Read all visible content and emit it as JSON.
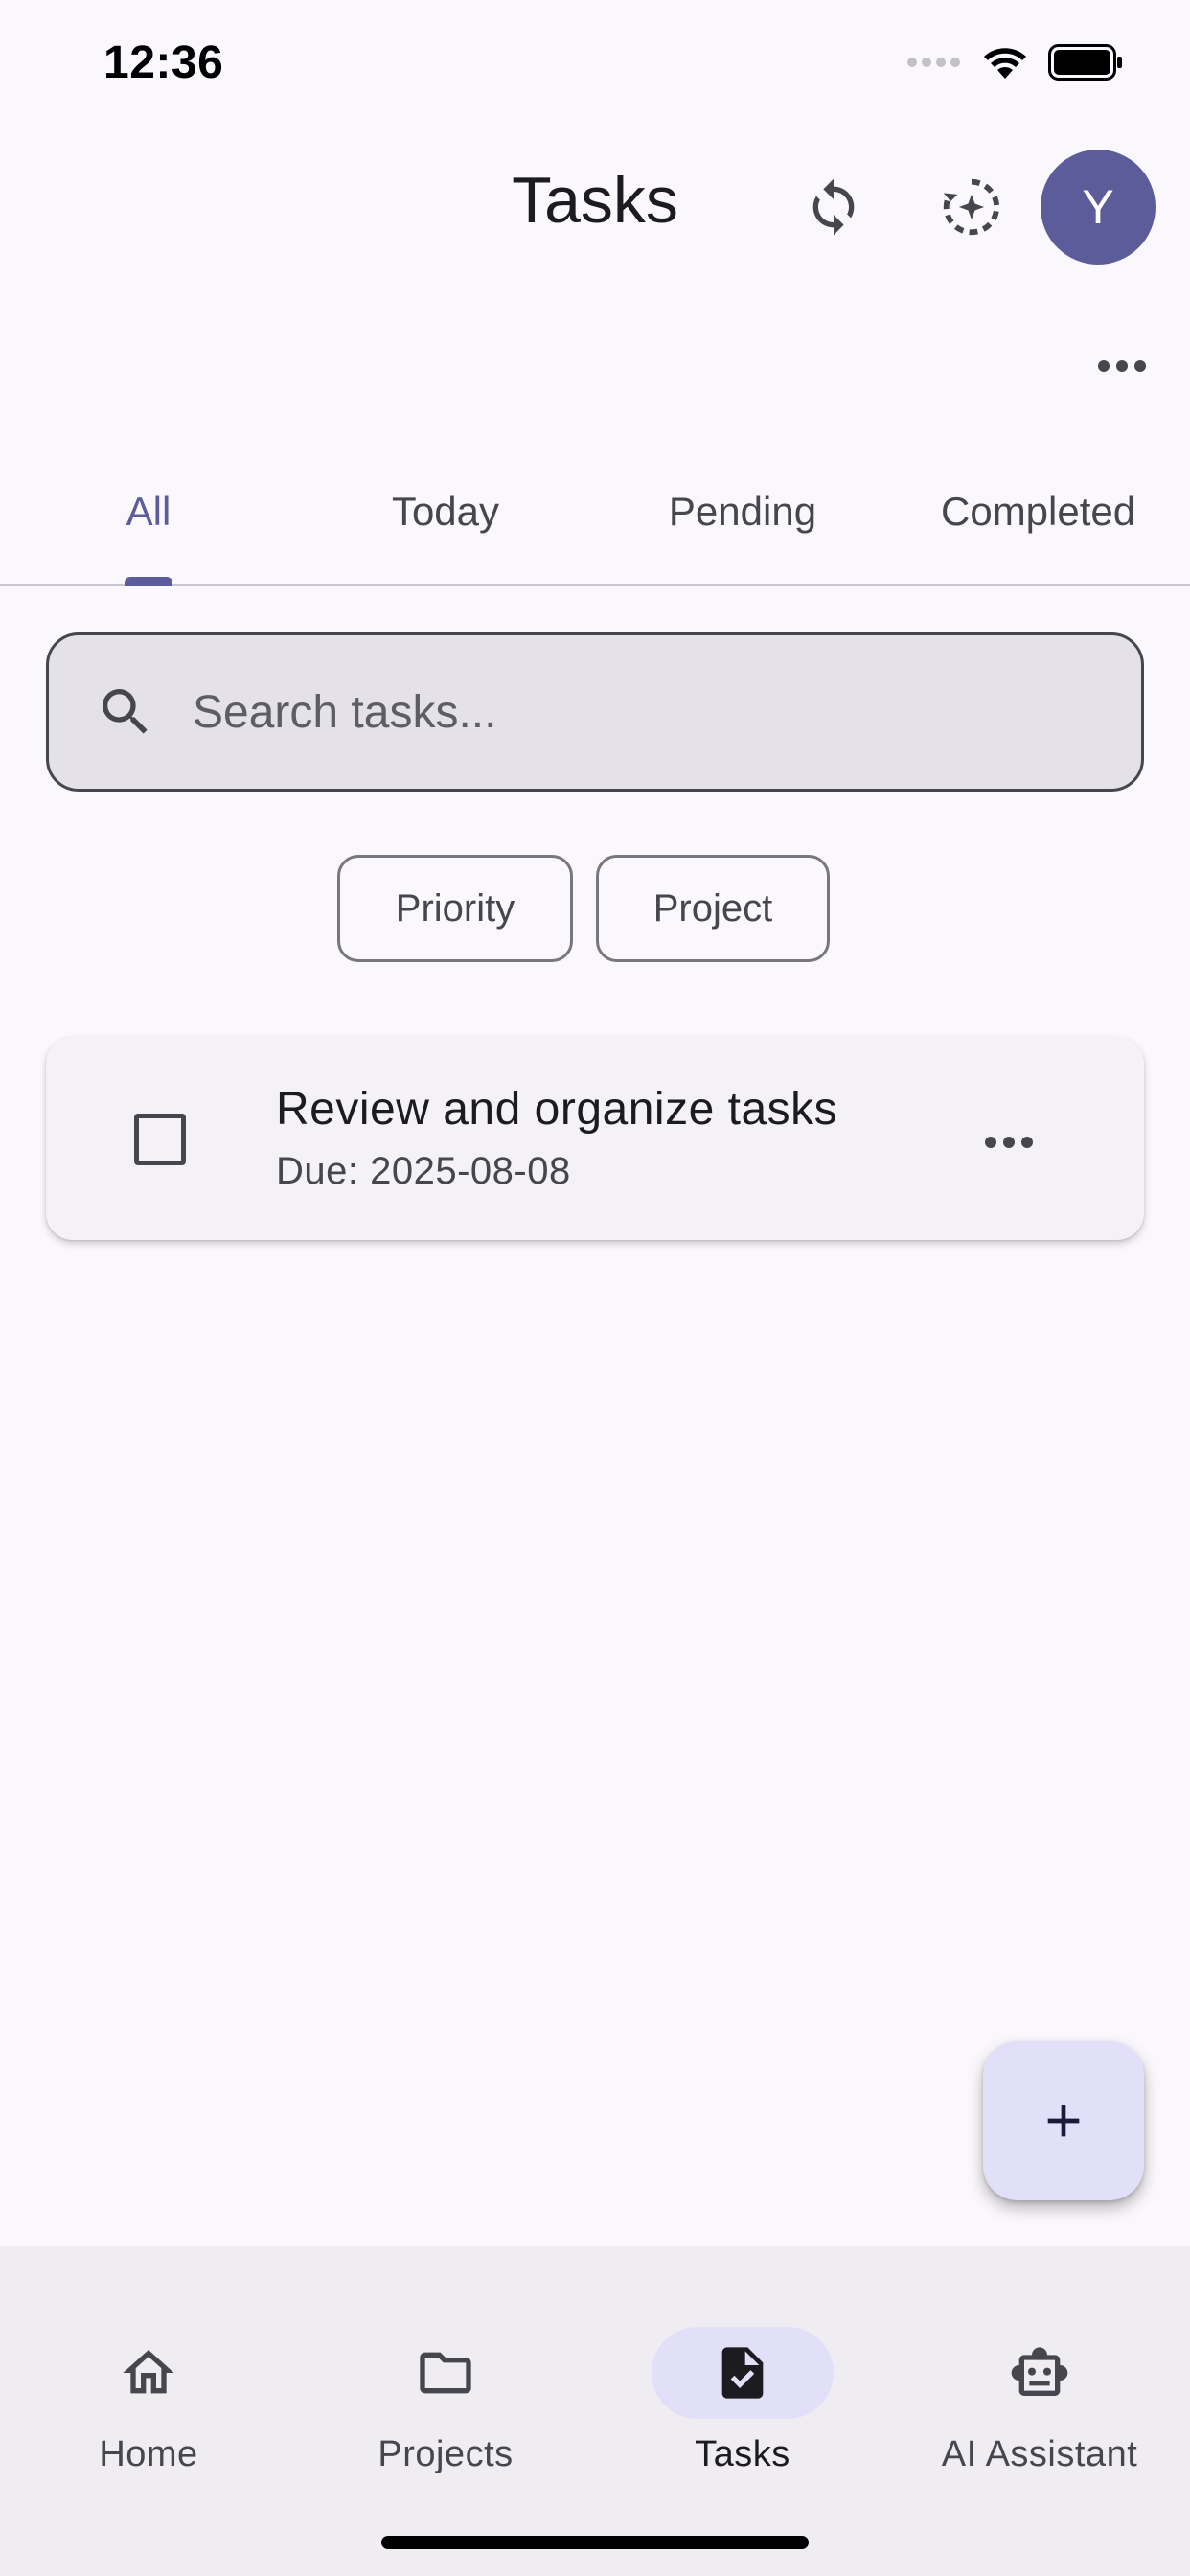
{
  "status_bar": {
    "time": "12:36"
  },
  "header": {
    "title": "Tasks",
    "avatar_initial": "Y",
    "icons": {
      "sync": "sync-icon",
      "ai": "ai-sparkle-icon",
      "more": "more-horizontal-icon"
    }
  },
  "tabs": [
    {
      "label": "All",
      "active": true
    },
    {
      "label": "Today",
      "active": false
    },
    {
      "label": "Pending",
      "active": false
    },
    {
      "label": "Completed",
      "active": false
    }
  ],
  "search": {
    "placeholder": "Search tasks..."
  },
  "filters": {
    "priority": "Priority",
    "project": "Project"
  },
  "tasks": [
    {
      "title": "Review and organize tasks",
      "due": "Due: 2025-08-08",
      "completed": false
    }
  ],
  "fab": {
    "icon": "plus-icon"
  },
  "bottom_nav": [
    {
      "label": "Home",
      "icon": "home-icon",
      "active": false
    },
    {
      "label": "Projects",
      "icon": "folder-icon",
      "active": false
    },
    {
      "label": "Tasks",
      "icon": "task-check-icon",
      "active": true
    },
    {
      "label": "AI Assistant",
      "icon": "robot-icon",
      "active": false
    }
  ],
  "colors": {
    "accent": "#5c5c9a",
    "background": "#fbf8fd",
    "fab": "#e2e0f9",
    "nav_background": "#efedf2"
  }
}
